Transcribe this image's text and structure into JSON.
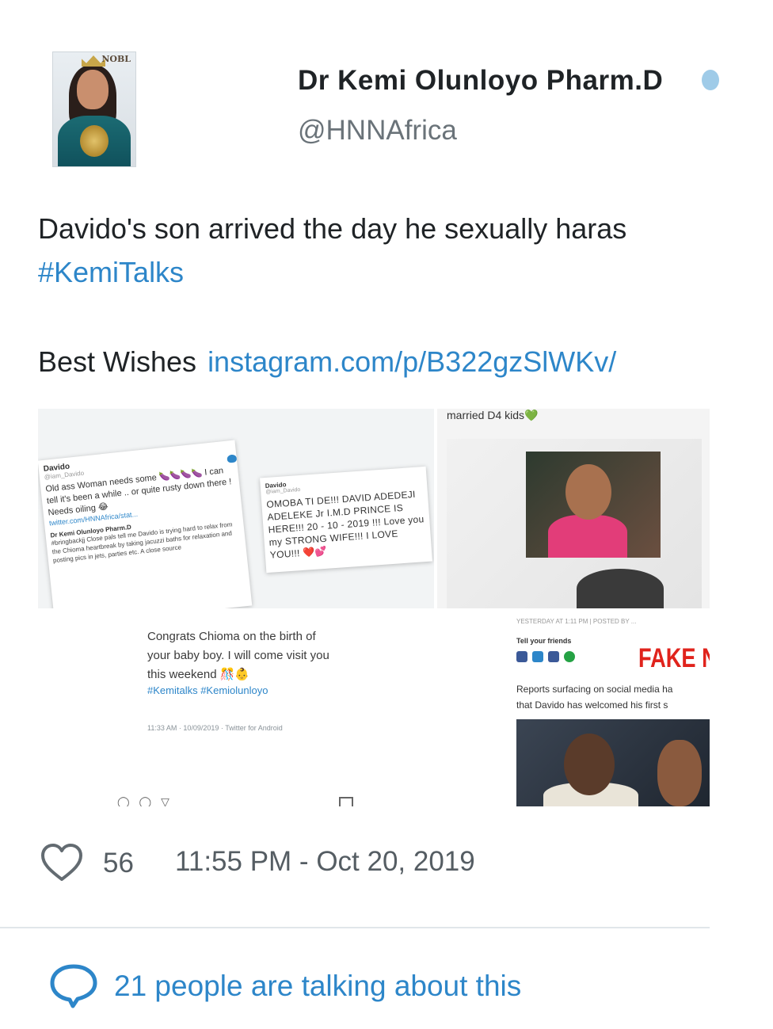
{
  "author": {
    "name": "Dr Kemi Olunloyo Pharm.D",
    "handle": "@HNNAfrica",
    "avatar_icon": "profile-photo",
    "avatar_mag_text": "NOBL"
  },
  "tweet": {
    "line1": "Davido's son arrived the day he sexually haras",
    "hashtag": "#KemiTalks",
    "line3_prefix": "Best Wishes",
    "link": "instagram.com/p/B322gzSlWKv/"
  },
  "media": {
    "top_left": {
      "card_a_name": "Davido",
      "card_a_handle": "@iam_Davido",
      "card_a_text": "Old ass Woman needs some 🍆🍆🍆🍆 I can tell it's been a while .. or quite rusty down there ! Needs oiling 😂",
      "card_a_link": "twitter.com/HNNAfrica/stat...",
      "card_a_sub_name": "Dr Kemi Olunloyo Pharm.D",
      "card_a_sub_text": "#bringbackjj Close pals tell me Davido is trying hard to relax from the Chioma heartbreak by taking jacuzzi baths for relaxation and posting pics in jets, parties etc. A close source",
      "card_b_name": "Davido",
      "card_b_handle": "@iam_Davido",
      "card_b_text": "OMOBA TI DE!!! DAVID ADEDEJI ADELEKE Jr I.M.D PRINCE IS HERE!!! 20 - 10 - 2019 !!! Love you my STRONG WIFE!!! I LOVE YOU!!! ❤️💕"
    },
    "top_right": {
      "caption": "married D4 kids💚"
    },
    "bottom_left": {
      "text": "Congrats Chioma on the birth of your baby boy. I will come visit you this weekend 🎊👶",
      "tags": "#Kemitalks #Kemiolunloyo",
      "meta": "11:33 AM · 10/09/2019 · Twitter for Android",
      "actions": "◯ ◯ ▽"
    },
    "bottom_right": {
      "meta": "YESTERDAY AT 1:11 PM | POSTED BY ...",
      "tell": "Tell your friends",
      "badge": "FAKE N",
      "report_line1": "Reports surfacing on social media ha",
      "report_line2": "that Davido has welcomed his first s"
    }
  },
  "stats": {
    "likes": "56",
    "timestamp": "11:55 PM - Oct 20, 2019",
    "talking": "21 people are talking about this"
  },
  "colors": {
    "link": "#2d86c9",
    "text": "#1f2326",
    "muted": "#555d63"
  }
}
